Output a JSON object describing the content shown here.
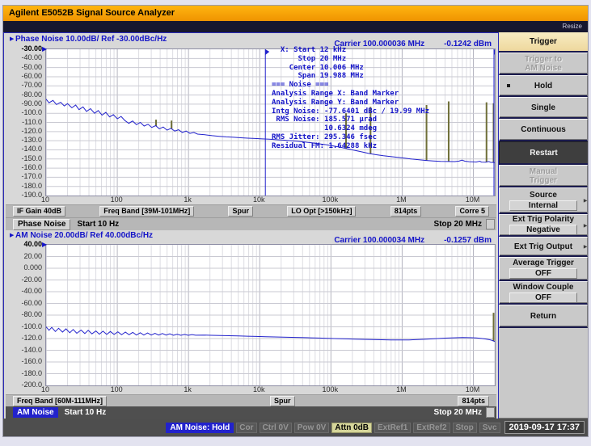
{
  "window": {
    "title": "Agilent E5052B Signal Source Analyzer",
    "resize_label": "Resize"
  },
  "colors": {
    "accent_blue": "#1414c8",
    "trace_blue": "#2222cc",
    "spur_olive": "#6f6f38",
    "title_orange": "#f7a000",
    "grid_major": "#b4b4c0",
    "grid_minor": "#dcdce2",
    "grid_horizontal": "#c9c9d2"
  },
  "phase_panel": {
    "header": "Phase Noise 10.00dB/ Ref -30.00dBc/Hz",
    "carrier": "Carrier 100.000036 MHz",
    "power": "-0.1242 dBm",
    "info_lines": [
      "  X: Start 12 kHz",
      "      Stop 20 MHz",
      "    Center 10.006 MHz",
      "      Span 19.988 MHz",
      "=== Noise ===",
      "Analysis Range X: Band Marker",
      "Analysis Range Y: Band Marker",
      "Intg Noise: -77.6401 dBc / 19.99 MHz",
      " RMS Noise: 185.571 µrad",
      "            10.6324 mdeg",
      "RMS Jitter: 295.346 fsec",
      "Residual FM: 1.64288 kHz"
    ],
    "chips": [
      "IF Gain 40dB",
      "Freq Band [39M-101MHz]",
      "Spur",
      "LO Opt [>150kHz]",
      "814pts",
      "Corre 5"
    ],
    "window_bar": {
      "label": "Phase Noise",
      "start": "Start 10 Hz",
      "stop": "Stop 20 MHz"
    }
  },
  "am_panel": {
    "header": "AM Noise 20.00dB/ Ref 40.00dBc/Hz",
    "carrier": "Carrier 100.000034 MHz",
    "power": "-0.1257 dBm",
    "chips": [
      "Freq Band [60M-111MHz]",
      "Spur",
      "814pts"
    ],
    "window_bar": {
      "label": "AM Noise",
      "start": "Start 10 Hz",
      "stop": "Stop 20 MHz"
    }
  },
  "sidebar": {
    "header": "Trigger",
    "buttons": [
      {
        "label": "Trigger to|AM Noise",
        "state": "disabled"
      },
      {
        "label": "Hold",
        "state": "selected"
      },
      {
        "label": "Single",
        "state": "normal"
      },
      {
        "label": "Continuous",
        "state": "normal"
      },
      {
        "label": "Restart",
        "state": "pressed"
      },
      {
        "label": "Manual|Trigger",
        "state": "disabled"
      },
      {
        "label": "Source",
        "value": "Internal",
        "arrow": true,
        "state": "normal"
      },
      {
        "label": "Ext Trig Polarity",
        "value": "Negative",
        "arrow": true,
        "state": "normal"
      },
      {
        "label": "Ext Trig Output",
        "arrow": true,
        "state": "normal"
      },
      {
        "label": "Average Trigger",
        "value": "OFF",
        "state": "normal"
      },
      {
        "label": "Window Couple",
        "value": "OFF",
        "state": "normal"
      },
      {
        "label": "Return",
        "state": "normal"
      }
    ]
  },
  "statusbar": {
    "items": [
      {
        "label": "AM Noise: Hold",
        "state": "active"
      },
      {
        "label": "Cor",
        "state": "dim"
      },
      {
        "label": "Ctrl 0V",
        "state": "dim"
      },
      {
        "label": "Pow 0V",
        "state": "dim"
      },
      {
        "label": "Attn 0dB",
        "state": "attn"
      },
      {
        "label": "ExtRef1",
        "state": "dim"
      },
      {
        "label": "ExtRef2",
        "state": "dim"
      },
      {
        "label": "Stop",
        "state": "dim"
      },
      {
        "label": "Svc",
        "state": "dim"
      }
    ],
    "datetime": "2019-09-17 17:37"
  },
  "chart_data": [
    {
      "type": "line",
      "title": "Phase Noise 10.00dB/ Ref -30.00dBc/Hz",
      "xscale": "log",
      "x_range_hz": [
        10,
        20000000
      ],
      "xticks": [
        "10",
        "100",
        "1k",
        "10k",
        "100k",
        "1M",
        "10M"
      ],
      "ylabel": "dBc/Hz",
      "ylim": [
        -190,
        -30
      ],
      "ytick_step": 10,
      "yticks": [
        "-30.00",
        "-40.00",
        "-50.00",
        "-60.00",
        "-70.00",
        "-80.00",
        "-90.00",
        "-100.0",
        "-110.0",
        "-120.0",
        "-130.0",
        "-140.0",
        "-150.0",
        "-160.0",
        "-170.0",
        "-180.0",
        "-190.0"
      ],
      "marker_lines_hz": [
        12000,
        20000000
      ],
      "series": [
        {
          "name": "phase-noise-trace",
          "points": [
            [
              10,
              -84.5
            ],
            [
              11,
              -88.5
            ],
            [
              12.5,
              -86
            ],
            [
              14,
              -90.5
            ],
            [
              16,
              -88
            ],
            [
              18,
              -92
            ],
            [
              20,
              -89.5
            ],
            [
              23,
              -94
            ],
            [
              26,
              -91
            ],
            [
              29,
              -96
            ],
            [
              33,
              -93
            ],
            [
              37,
              -98
            ],
            [
              42,
              -95
            ],
            [
              48,
              -100
            ],
            [
              54,
              -97
            ],
            [
              61,
              -102
            ],
            [
              69,
              -99
            ],
            [
              78,
              -104
            ],
            [
              88,
              -101.5
            ],
            [
              100,
              -106
            ],
            [
              113,
              -103.5
            ],
            [
              128,
              -108
            ],
            [
              145,
              -111
            ],
            [
              164,
              -108.5
            ],
            [
              186,
              -112.5
            ],
            [
              210,
              -110
            ],
            [
              238,
              -114
            ],
            [
              270,
              -112
            ],
            [
              305,
              -115.5
            ],
            [
              345,
              -113.5
            ],
            [
              390,
              -117
            ],
            [
              442,
              -115
            ],
            [
              500,
              -118.5
            ],
            [
              566,
              -116.5
            ],
            [
              640,
              -119.5
            ],
            [
              724,
              -118
            ],
            [
              819,
              -121
            ],
            [
              927,
              -119.5
            ],
            [
              1049,
              -122
            ],
            [
              1187,
              -121
            ],
            [
              1343,
              -122.8
            ],
            [
              1700,
              -123.5
            ],
            [
              2150,
              -124.5
            ],
            [
              2700,
              -125.2
            ],
            [
              3400,
              -125.8
            ],
            [
              4300,
              -126.3
            ],
            [
              5400,
              -126.8
            ],
            [
              6800,
              -127.2
            ],
            [
              8600,
              -127.6
            ],
            [
              10800,
              -128
            ],
            [
              13600,
              -128.4
            ],
            [
              17000,
              -128.9
            ],
            [
              21500,
              -129.4
            ],
            [
              27000,
              -130
            ],
            [
              34000,
              -130.7
            ],
            [
              43000,
              -131.5
            ],
            [
              54000,
              -132.4
            ],
            [
              68000,
              -133.4
            ],
            [
              86000,
              -134.4
            ],
            [
              108000,
              -135.7
            ],
            [
              136000,
              -137.2
            ],
            [
              172000,
              -138.9
            ],
            [
              216000,
              -140.6
            ],
            [
              273000,
              -142.3
            ],
            [
              344000,
              -144
            ],
            [
              433000,
              -145.4
            ],
            [
              546000,
              -146.5
            ],
            [
              688000,
              -147.4
            ],
            [
              867000,
              -148.3
            ],
            [
              1092000,
              -149.2
            ],
            [
              1376000,
              -150.1
            ],
            [
              1733000,
              -150.9
            ],
            [
              2183000,
              -151.6
            ],
            [
              2750000,
              -152.2
            ],
            [
              3464000,
              -152.6
            ],
            [
              4364000,
              -152.8
            ],
            [
              5497000,
              -152.9
            ],
            [
              6300000,
              -152.3
            ],
            [
              6925000,
              -151.2
            ],
            [
              7600000,
              -152.4
            ],
            [
              8724000,
              -153
            ],
            [
              10990000,
              -153.3
            ],
            [
              12300000,
              -152.4
            ],
            [
              13000000,
              -153.4
            ],
            [
              15000000,
              -153.5
            ],
            [
              16500000,
              -152.8
            ],
            [
              17440000,
              -153.7
            ],
            [
              20000000,
              -154
            ]
          ]
        }
      ],
      "spurs": [
        [
          350,
          -107
        ],
        [
          577,
          -108
        ],
        [
          163000,
          -100
        ],
        [
          360000,
          -93
        ],
        [
          2200000,
          -91
        ],
        [
          4500000,
          -87
        ],
        [
          15300000,
          -88
        ],
        [
          19600000,
          -89
        ]
      ]
    },
    {
      "type": "line",
      "title": "AM Noise 20.00dB/ Ref 40.00dBc/Hz",
      "xscale": "log",
      "x_range_hz": [
        10,
        20000000
      ],
      "xticks": [
        "10",
        "100",
        "1k",
        "10k",
        "100k",
        "1M",
        "10M"
      ],
      "ylabel": "dBc/Hz",
      "ylim": [
        -200,
        40
      ],
      "ytick_step": 20,
      "yticks": [
        "40.00",
        "20.00",
        "0.000",
        "-20.00",
        "-40.00",
        "-60.00",
        "-80.00",
        "-100.0",
        "-120.0",
        "-140.0",
        "-160.0",
        "-180.0",
        "-200.0"
      ],
      "marker_lines_hz": [],
      "series": [
        {
          "name": "am-noise-trace",
          "points": [
            [
              10,
              -100
            ],
            [
              11,
              -106
            ],
            [
              12,
              -101
            ],
            [
              13.5,
              -108
            ],
            [
              15,
              -102.5
            ],
            [
              17,
              -109
            ],
            [
              19,
              -103.5
            ],
            [
              21.5,
              -110
            ],
            [
              24,
              -104.5
            ],
            [
              27,
              -111
            ],
            [
              31,
              -105.5
            ],
            [
              35,
              -111.5
            ],
            [
              39,
              -106
            ],
            [
              44,
              -112
            ],
            [
              50,
              -107
            ],
            [
              56,
              -112.5
            ],
            [
              63,
              -107.5
            ],
            [
              71,
              -113
            ],
            [
              80,
              -108
            ],
            [
              90,
              -113
            ],
            [
              102,
              -108.5
            ],
            [
              115,
              -113.5
            ],
            [
              130,
              -109
            ],
            [
              146,
              -113.5
            ],
            [
              165,
              -109.5
            ],
            [
              186,
              -114
            ],
            [
              210,
              -110
            ],
            [
              236,
              -114
            ],
            [
              266,
              -110.5
            ],
            [
              300,
              -114
            ],
            [
              338,
              -111
            ],
            [
              381,
              -114
            ],
            [
              430,
              -111.5
            ],
            [
              484,
              -114
            ],
            [
              546,
              -112
            ],
            [
              615,
              -114.5
            ],
            [
              693,
              -112.5
            ],
            [
              781,
              -114.5
            ],
            [
              880,
              -113
            ],
            [
              992,
              -114.5
            ],
            [
              1118,
              -113.3
            ],
            [
              1260,
              -114.3
            ],
            [
              1600,
              -114
            ],
            [
              2100,
              -114.5
            ],
            [
              2800,
              -114.8
            ],
            [
              3700,
              -115.2
            ],
            [
              5000,
              -115.6
            ],
            [
              6700,
              -116
            ],
            [
              9000,
              -116.4
            ],
            [
              12000,
              -116.8
            ],
            [
              16000,
              -117.2
            ],
            [
              21000,
              -117.6
            ],
            [
              28000,
              -118
            ],
            [
              38000,
              -118.4
            ],
            [
              51000,
              -118.8
            ],
            [
              68000,
              -119.2
            ],
            [
              91000,
              -119.6
            ],
            [
              122000,
              -120.1
            ],
            [
              163000,
              -120.6
            ],
            [
              218000,
              -121
            ],
            [
              291000,
              -121.4
            ],
            [
              389000,
              -121.8
            ],
            [
              520000,
              -122.1
            ],
            [
              695000,
              -122.3
            ],
            [
              929000,
              -122.4
            ],
            [
              1242000,
              -122.3
            ],
            [
              1660000,
              -121.8
            ],
            [
              2219000,
              -121
            ],
            [
              2966000,
              -120.1
            ],
            [
              3965000,
              -119.3
            ],
            [
              5300000,
              -118.7
            ],
            [
              7084000,
              -118.3
            ],
            [
              9469000,
              -118.6
            ],
            [
              11000000,
              -119
            ],
            [
              13000000,
              -119.8
            ],
            [
              15000000,
              -120.8
            ],
            [
              17000000,
              -122
            ],
            [
              18500000,
              -123.3
            ],
            [
              19500000,
              -124.5
            ],
            [
              20000000,
              -125.3
            ]
          ]
        }
      ],
      "spurs": [
        [
          19700000,
          -76
        ]
      ]
    }
  ]
}
